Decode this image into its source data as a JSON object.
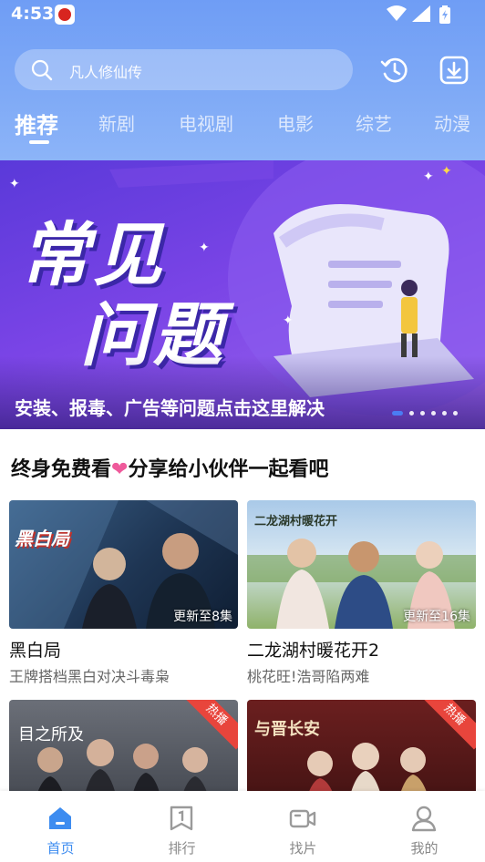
{
  "status_bar": {
    "time": "4:53"
  },
  "search": {
    "placeholder": "凡人修仙传"
  },
  "tabs": [
    {
      "label": "推荐",
      "active": true
    },
    {
      "label": "新剧",
      "active": false
    },
    {
      "label": "电视剧",
      "active": false
    },
    {
      "label": "电影",
      "active": false
    },
    {
      "label": "综艺",
      "active": false
    },
    {
      "label": "动漫",
      "active": false
    }
  ],
  "banner": {
    "title_line1": "常见",
    "title_line2": "问题",
    "caption": "安装、报毒、广告等问题点击这里解决",
    "dot_count": 6,
    "active_dot": 0
  },
  "section": {
    "title_left": "终身免费看",
    "heart": "❤",
    "title_right": "分享给小伙伴一起看吧"
  },
  "cards": [
    {
      "title": "黑白局",
      "subtitle": "王牌搭档黑白对决斗毒枭",
      "update": "更新至8集",
      "poster_text": "黑白局",
      "hot": false
    },
    {
      "title": "二龙湖村暖花开2",
      "subtitle": "桃花旺!浩哥陷两难",
      "update": "更新至16集",
      "poster_text": "二龙湖村暖花开",
      "hot": false
    },
    {
      "title": "",
      "subtitle": "",
      "update": "",
      "poster_text": "目之所及",
      "hot": true,
      "hot_label": "热播"
    },
    {
      "title": "",
      "subtitle": "",
      "update": "",
      "poster_text": "与晋长安",
      "hot": true,
      "hot_label": "热播"
    }
  ],
  "bottom_nav": [
    {
      "label": "首页",
      "icon": "home-icon",
      "active": true
    },
    {
      "label": "排行",
      "icon": "ranking-icon",
      "active": false
    },
    {
      "label": "找片",
      "icon": "video-camera-icon",
      "active": false
    },
    {
      "label": "我的",
      "icon": "profile-icon",
      "active": false
    }
  ],
  "colors": {
    "accent": "#3d8cf0",
    "header_top": "#6f9df5",
    "banner": "#6a3fe0",
    "heart": "#ef5a9b",
    "hot_badge": "#e8453c"
  }
}
